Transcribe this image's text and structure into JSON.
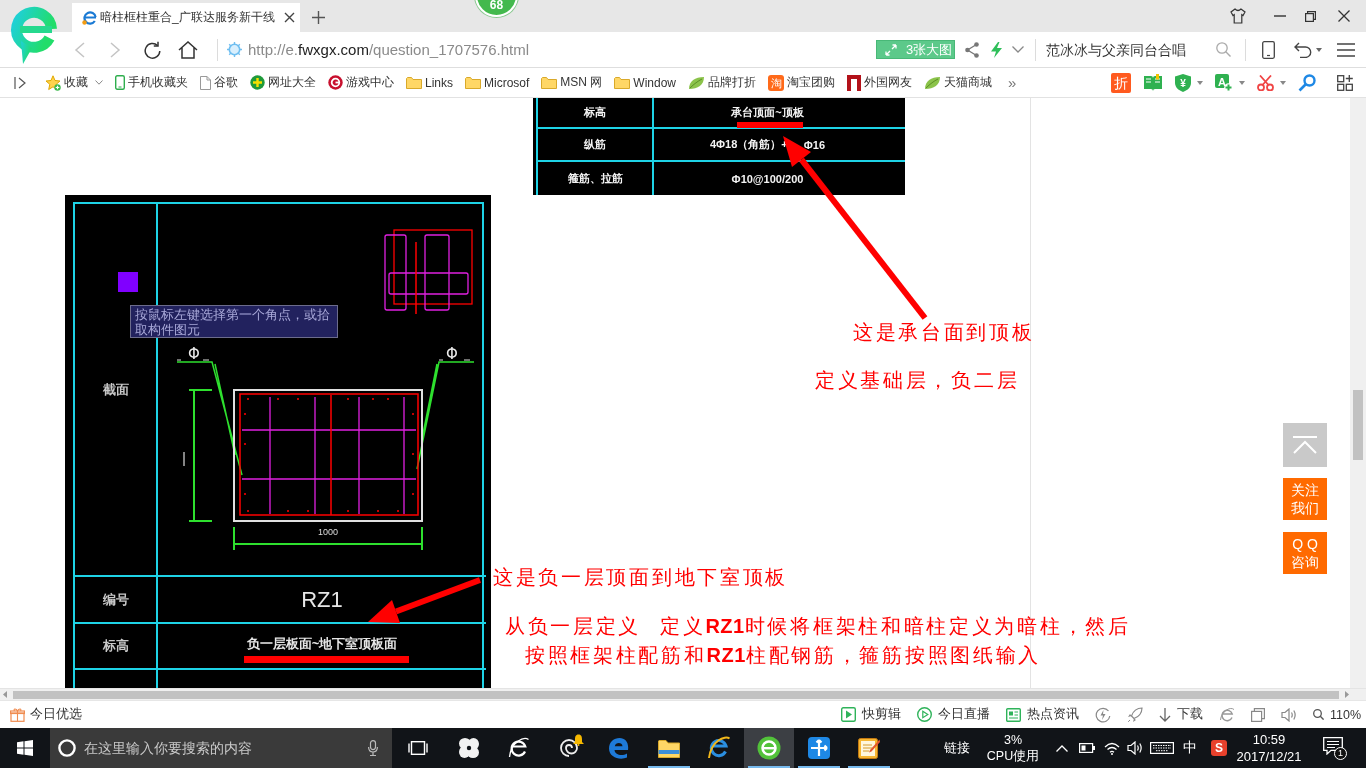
{
  "browser": {
    "tabs": [
      {
        "title": "暗柱框柱重合_广联达服务新干线",
        "selected": true
      }
    ],
    "badge": "68",
    "nav_buttons": [
      {
        "kind": "back",
        "disabled": true
      },
      {
        "kind": "forward",
        "disabled": true
      },
      {
        "kind": "refresh",
        "disabled": false
      },
      {
        "kind": "home",
        "disabled": false
      }
    ],
    "address": {
      "prefix": "http://e.",
      "domain": "fwxgx.com",
      "path": "/question_1707576.html"
    },
    "image_button": "3张大图",
    "search": {
      "placeholder": "范冰冰与父亲同台合唱"
    }
  },
  "bookmarks": {
    "items": [
      {
        "kind": "favorites",
        "label": "收藏",
        "dropdown": true
      },
      {
        "kind": "phone",
        "label": "手机收藏夹",
        "dropdown": false
      },
      {
        "kind": "page",
        "label": "谷歌",
        "dropdown": false
      },
      {
        "kind": "nav",
        "label": "网址大全",
        "dropdown": false
      },
      {
        "kind": "game",
        "label": "游戏中心",
        "dropdown": false
      },
      {
        "kind": "folder",
        "label": "Links",
        "dropdown": false
      },
      {
        "kind": "folder",
        "label": "Microsof",
        "dropdown": false
      },
      {
        "kind": "folder",
        "label": "MSN 网",
        "dropdown": false
      },
      {
        "kind": "folder",
        "label": "Window",
        "dropdown": false
      },
      {
        "kind": "leaf",
        "label": "品牌打折",
        "dropdown": false
      },
      {
        "kind": "glyph",
        "glyph": "淘",
        "label": "淘宝团购",
        "dropdown": false
      },
      {
        "kind": "flag",
        "label": "外国网友",
        "dropdown": false
      },
      {
        "kind": "leaf",
        "label": "天猫商城",
        "dropdown": false
      }
    ],
    "more": "»",
    "tools": [
      {
        "kind": "discount",
        "glyph": "折",
        "dropdown": false
      },
      {
        "kind": "book",
        "dropdown": false
      },
      {
        "kind": "shield",
        "glyph": "¥",
        "dropdown": true
      },
      {
        "kind": "translate",
        "glyph": "A",
        "dropdown": true
      },
      {
        "kind": "scissors",
        "dropdown": true
      },
      {
        "kind": "key",
        "dropdown": false
      },
      {
        "kind": "apps",
        "dropdown": false
      }
    ]
  },
  "article": {
    "top_drawing": {
      "rows": [
        {
          "label": "标高",
          "values": [
            "承台顶面~顶板"
          ]
        },
        {
          "label": "纵筋",
          "values": [
            "4Φ18（角筋）+",
            "Φ16"
          ]
        },
        {
          "label": "箍筋、拉筋",
          "values": [
            "Φ10@100/200"
          ]
        }
      ]
    },
    "main_drawing": {
      "tooltip": "按鼠标左键选择第一个角点，或拾取构件图元",
      "section_label": "截面",
      "section_marks": [
        "Φ",
        "Φ"
      ],
      "dimension": "1000",
      "rows": [
        {
          "label": "编号",
          "value": "RZ1"
        },
        {
          "label": "标高",
          "value": "负一层板面~地下室顶板面"
        }
      ]
    },
    "notes": [
      "这是承台面到顶板",
      "定义基础层，负二层",
      "这是负一层顶面到地下室顶板",
      "从负一层定义",
      "定义**RZ1**时候将框架柱和暗柱定义为暗柱，然后",
      "按照框架柱配筋和**RZ1**柱配钢筋，箍筋按照图纸输入"
    ]
  },
  "side_buttons": [
    {
      "kind": "back_to_top"
    },
    {
      "kind": "text",
      "lines": [
        "关注",
        "我们"
      ]
    },
    {
      "kind": "text",
      "lines": [
        "Q Q",
        "咨询"
      ]
    }
  ],
  "status_bar": {
    "left": "今日优选",
    "items": [
      {
        "kind": "clip",
        "label": "快剪辑"
      },
      {
        "kind": "live",
        "label": "今日直播"
      },
      {
        "kind": "news",
        "label": "热点资讯"
      },
      {
        "kind": "speed"
      },
      {
        "kind": "rocket"
      },
      {
        "kind": "download",
        "label": "下载"
      },
      {
        "kind": "ie"
      },
      {
        "kind": "window"
      },
      {
        "kind": "sound"
      },
      {
        "kind": "zoom",
        "label": "110%"
      }
    ]
  },
  "taskbar": {
    "search": {
      "placeholder": "在这里输入你要搜索的内容"
    },
    "apps": [
      {
        "kind": "pinwheel",
        "running": false,
        "selected": false
      },
      {
        "kind": "ie_outline",
        "running": false,
        "selected": false
      },
      {
        "kind": "swirl",
        "running": false,
        "selected": false
      },
      {
        "kind": "edge",
        "running": false,
        "selected": false
      },
      {
        "kind": "explorer",
        "running": true,
        "selected": false
      },
      {
        "kind": "ie",
        "running": false,
        "selected": false
      },
      {
        "kind": "browser",
        "running": true,
        "selected": true
      },
      {
        "kind": "blueapp",
        "running": true,
        "selected": false
      },
      {
        "kind": "notes",
        "running": true,
        "selected": false
      }
    ],
    "links": "链接",
    "cpu": [
      "3%",
      "CPU使用"
    ],
    "ime": "中",
    "sogou": "S",
    "time": "10:59",
    "date": "2017/12/21",
    "notifications": "1"
  }
}
